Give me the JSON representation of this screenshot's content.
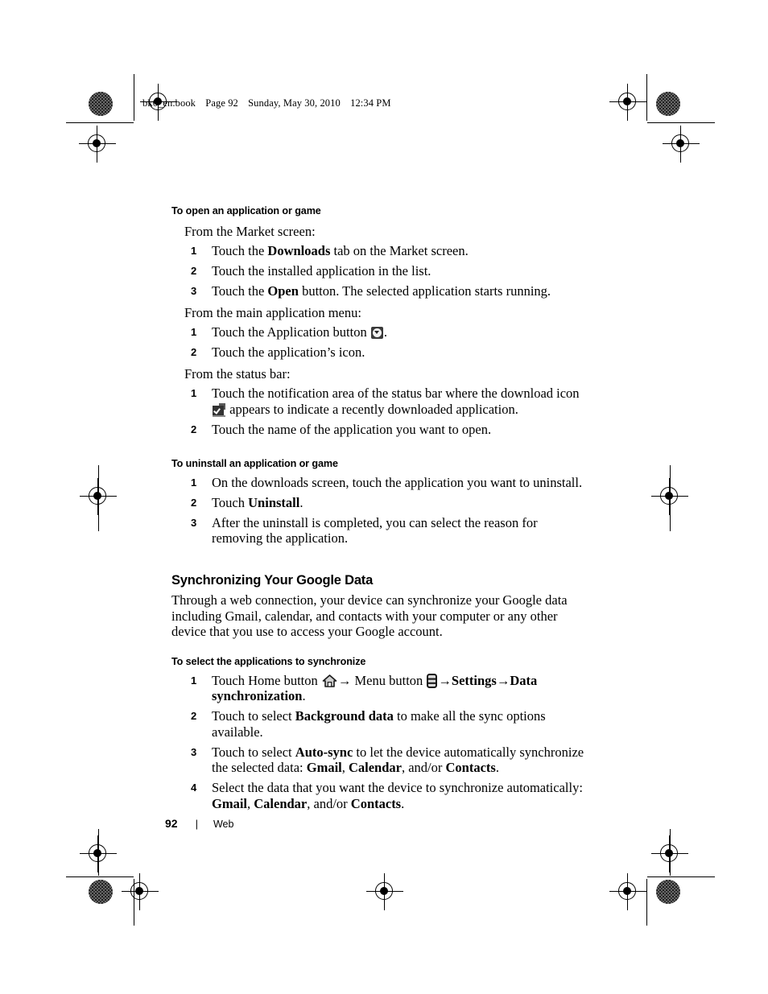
{
  "header": {
    "file": "bk0_en.book",
    "page_label": "Page 92",
    "date": "Sunday, May 30, 2010",
    "time": "12:34 PM"
  },
  "content": {
    "section_open": {
      "heading": "To open an application or game",
      "leadin_market": "From the Market screen:",
      "market_steps": [
        {
          "num": "1",
          "pre": "Touch the ",
          "bold": "Downloads",
          "post": " tab on the Market screen."
        },
        {
          "num": "2",
          "pre": "Touch the installed application in the list.",
          "bold": "",
          "post": ""
        },
        {
          "num": "3",
          "pre": "Touch the ",
          "bold": "Open",
          "post": " button. The selected application starts running."
        }
      ],
      "leadin_menu": "From the main application menu:",
      "menu_steps": [
        {
          "num": "1",
          "pre": "Touch the Application button ",
          "post": "."
        },
        {
          "num": "2",
          "pre": "Touch the application’s icon.",
          "post": ""
        }
      ],
      "leadin_status": "From the status bar:",
      "status_step_1_num": "1",
      "status_step_1_pre": "Touch the notification area of the status bar where the download icon ",
      "status_step_1_post": " appears to indicate a recently downloaded application.",
      "status_step_2_num": "2",
      "status_step_2_text": "Touch the name of the application you want to open."
    },
    "section_uninstall": {
      "heading": "To uninstall an application or game",
      "steps": [
        {
          "num": "1",
          "pre": "On the downloads screen, touch the application you want to uninstall.",
          "bold": "",
          "post": ""
        },
        {
          "num": "2",
          "pre": "Touch ",
          "bold": "Uninstall",
          "post": "."
        },
        {
          "num": "3",
          "pre": "After the uninstall is completed, you can select the reason for removing the application.",
          "bold": "",
          "post": ""
        }
      ]
    },
    "section_sync": {
      "heading": "Synchronizing Your Google Data",
      "paragraph": "Through a web connection, your device can synchronize your Google data including Gmail, calendar, and contacts with your computer or any other device that you use to access your Google account.",
      "sub_heading": "To select the applications to synchronize",
      "step1": {
        "num": "1",
        "t1": "Touch Home button ",
        "a1": "→",
        "t2": " Menu button ",
        "a2": "→",
        "b1": "Settings",
        "a3": "→",
        "b2": "Data synchronization",
        "t3": "."
      },
      "step2": {
        "num": "2",
        "pre": "Touch to select ",
        "bold": "Background data",
        "post": " to make all the sync options available."
      },
      "step3": {
        "num": "3",
        "pre": "Touch to select ",
        "b1": "Auto-sync",
        "mid1": " to let the device automatically synchronize the selected data: ",
        "b2": "Gmail",
        "mid2": ", ",
        "b3": "Calendar",
        "mid3": ", and/or ",
        "b4": "Contacts",
        "post": "."
      },
      "step4": {
        "num": "4",
        "pre": "Select the data that you want the device to synchronize automatically: ",
        "b1": "Gmail",
        "mid1": ", ",
        "b2": "Calendar",
        "mid2": ", and/or ",
        "b3": "Contacts",
        "post": "."
      }
    }
  },
  "footer": {
    "page_number": "92",
    "separator": "|",
    "chapter": "Web"
  },
  "icons": {
    "application_button": "application-button-icon",
    "download": "download-notification-icon",
    "home": "home-button-icon",
    "menu": "menu-button-icon"
  }
}
